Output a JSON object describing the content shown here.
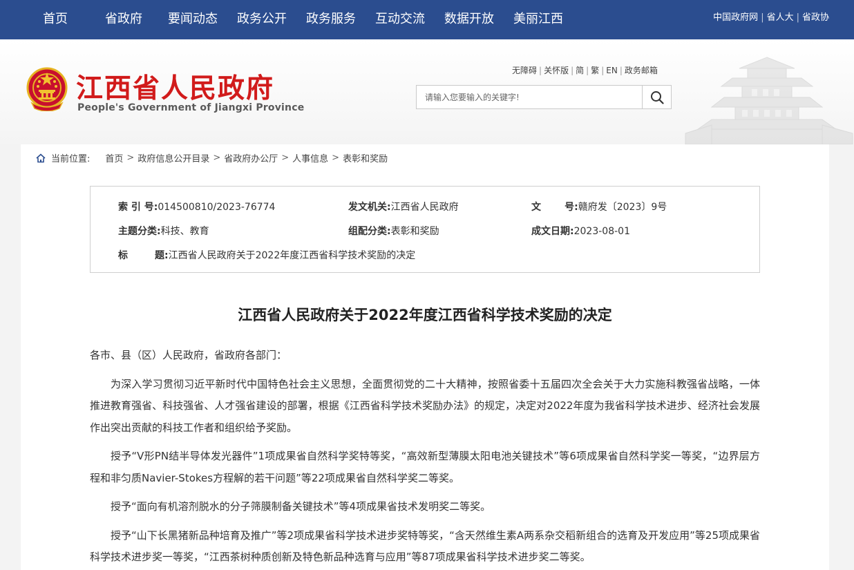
{
  "nav": {
    "items": [
      "首页",
      "省政府",
      "要闻动态",
      "政务公开",
      "政务服务",
      "互动交流",
      "数据开放",
      "美丽江西"
    ],
    "links": [
      "中国政府网",
      "省人大",
      "省政协"
    ]
  },
  "header": {
    "site_name": "江西省人民政府",
    "site_name_en": "People's Government of Jiangxi Province",
    "util_links": [
      "无障碍",
      "关怀版",
      "简",
      "繁",
      "EN",
      "政务邮箱"
    ],
    "search_placeholder": "请输入您要输入的关键字!"
  },
  "breadcrumb": {
    "label": "当前位置:",
    "items": [
      "首页",
      "政府信息公开目录",
      "省政府办公厅",
      "人事信息",
      "表彰和奖励"
    ]
  },
  "meta": {
    "index_label": "索  引  号:",
    "index_value": "014500810/2023-76774",
    "issuer_label": "发文机关:",
    "issuer_value": "江西省人民政府",
    "doc_no_label": "文       号:",
    "doc_no_value": "赣府发〔2023〕9号",
    "topic_label": "主题分类:",
    "topic_value": "科技、教育",
    "category_label": "组配分类:",
    "category_value": "表彰和奖励",
    "date_label": "成文日期:",
    "date_value": "2023-08-01",
    "title_label": "标        题:",
    "title_value": "江西省人民政府关于2022年度江西省科学技术奖励的决定"
  },
  "document": {
    "title": "江西省人民政府关于2022年度江西省科学技术奖励的决定",
    "salutation": "各市、县（区）人民政府，省政府各部门：",
    "paragraphs": [
      "为深入学习贯彻习近平新时代中国特色社会主义思想，全面贯彻党的二十大精神，按照省委十五届四次全会关于大力实施科教强省战略，一体推进教育强省、科技强省、人才强省建设的部署，根据《江西省科学技术奖励办法》的规定，决定对2022年度为我省科学技术进步、经济社会发展作出突出贡献的科技工作者和组织给予奖励。",
      "授予“V形PN结半导体发光器件”1项成果省自然科学奖特等奖，“高效新型薄膜太阳电池关键技术”等6项成果省自然科学奖一等奖，“边界层方程和非匀质Navier-Stokes方程解的若干问题”等22项成果省自然科学奖二等奖。",
      "授予“面向有机溶剂脱水的分子筛膜制备关键技术”等4项成果省技术发明奖二等奖。",
      "授予“山下长黑猪新品种培育及推广”等2项成果省科学技术进步奖特等奖，“含天然维生素A两系杂交稻新组合的选育及开发应用”等25项成果省科学技术进步奖一等奖，“江西茶树种质创新及特色新品种选育与应用”等87项成果省科学技术进步奖二等奖。"
    ]
  },
  "colors": {
    "nav_bg": "#2b4d8f",
    "brand_red": "#d11b1b"
  }
}
